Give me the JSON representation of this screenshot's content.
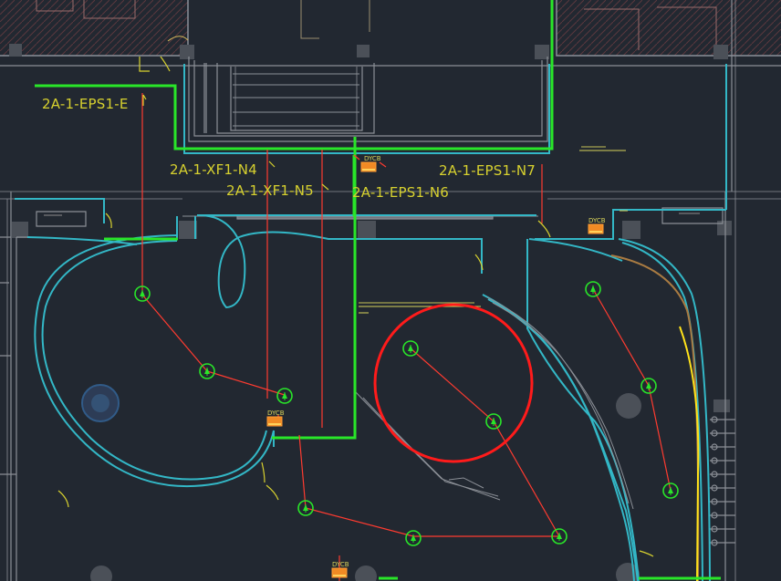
{
  "labels": {
    "label_e": "2A-1-EPS1-E",
    "label_n4": "2A-1-XF1-N4",
    "label_n5": "2A-1-XF1-N5",
    "label_n6": "2A-1-EPS1-N6",
    "label_n7": "2A-1-EPS1-N7"
  },
  "devices": {
    "dyc": "DYCB"
  },
  "colors": {
    "background": "#222831",
    "green_circuit": "#29e629",
    "teal_wall": "#33b7c6",
    "red_wire": "#ff3b30",
    "yellow_text": "#d7d12f",
    "gray_structure": "#8b8f96"
  },
  "icons": {
    "sprinkler_symbol": "green-sprinkler-icon"
  }
}
